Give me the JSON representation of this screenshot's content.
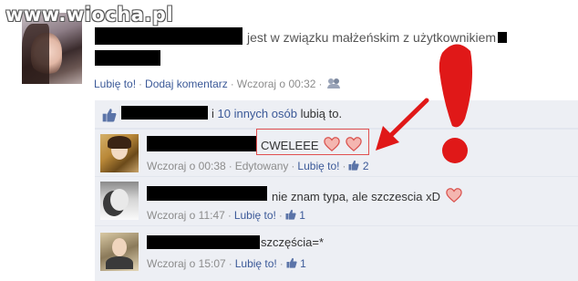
{
  "watermark": "www.wiocha.pl",
  "post": {
    "status_text": "jest w związku małżeńskim z użytkownikiem",
    "actions": {
      "like": "Lubię to!",
      "comment": "Dodaj komentarz",
      "time": "Wczoraj o 00:32"
    }
  },
  "likes": {
    "text_pre": "i ",
    "others_link": "10 innych osób",
    "text_post": " lubią to."
  },
  "comments": [
    {
      "text": "CWELEEE",
      "time": "Wczoraj o 00:38",
      "edited": "Edytowany",
      "like": "Lubię to!",
      "like_count": "2",
      "hearts": 2
    },
    {
      "text": "nie znam typa, ale szczescia xD",
      "time": "Wczoraj o 11:47",
      "like": "Lubię to!",
      "like_count": "1",
      "hearts": 1
    },
    {
      "text": "szczęścia=*",
      "time": "Wczoraj o 15:07",
      "like": "Lubię to!",
      "like_count": "1",
      "hearts": 0
    }
  ],
  "colors": {
    "link": "#3b5998",
    "meta": "#8c8c8c",
    "comments_bg": "#edeff4",
    "annotation_red": "#e01818",
    "heart_fill": "#f4b6b0",
    "heart_stroke": "#d9534f"
  },
  "icons": {
    "friends": "friends-icon",
    "like": "thumbs-up-icon",
    "heart": "heart-icon",
    "exclamation": "exclamation-mark-annotation",
    "arrow": "red-arrow-annotation"
  }
}
